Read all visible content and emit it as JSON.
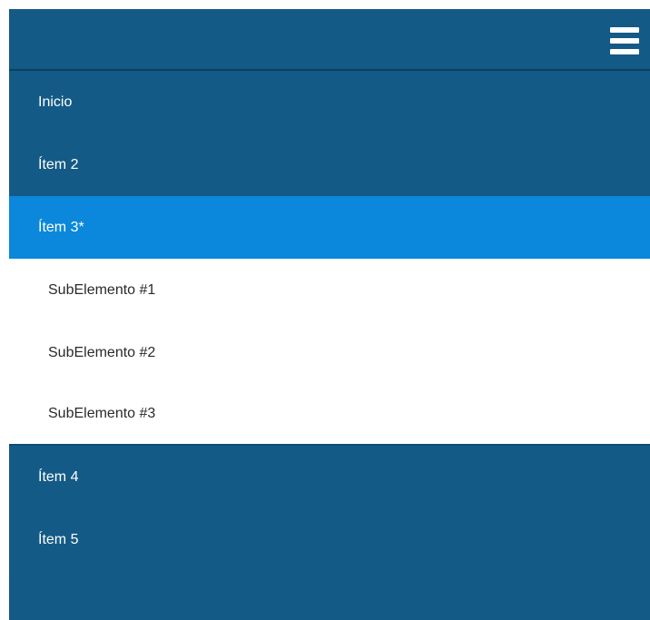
{
  "colors": {
    "nav_bg": "#135a86",
    "active_bg": "#0b88db",
    "submenu_bg": "#ffffff",
    "text_light": "#ffffff",
    "text_dark": "#2a2a2a"
  },
  "header": {
    "menu_icon": "hamburger-menu-icon"
  },
  "menu": {
    "items": [
      {
        "label": "Inicio"
      },
      {
        "label": "Ítem 2"
      },
      {
        "label": "Ítem 3*",
        "active": true,
        "subitems": [
          {
            "label": "SubElemento #1"
          },
          {
            "label": "SubElemento #2"
          },
          {
            "label": "SubElemento #3"
          }
        ]
      },
      {
        "label": "Ítem 4"
      },
      {
        "label": "Ítem 5"
      }
    ]
  }
}
